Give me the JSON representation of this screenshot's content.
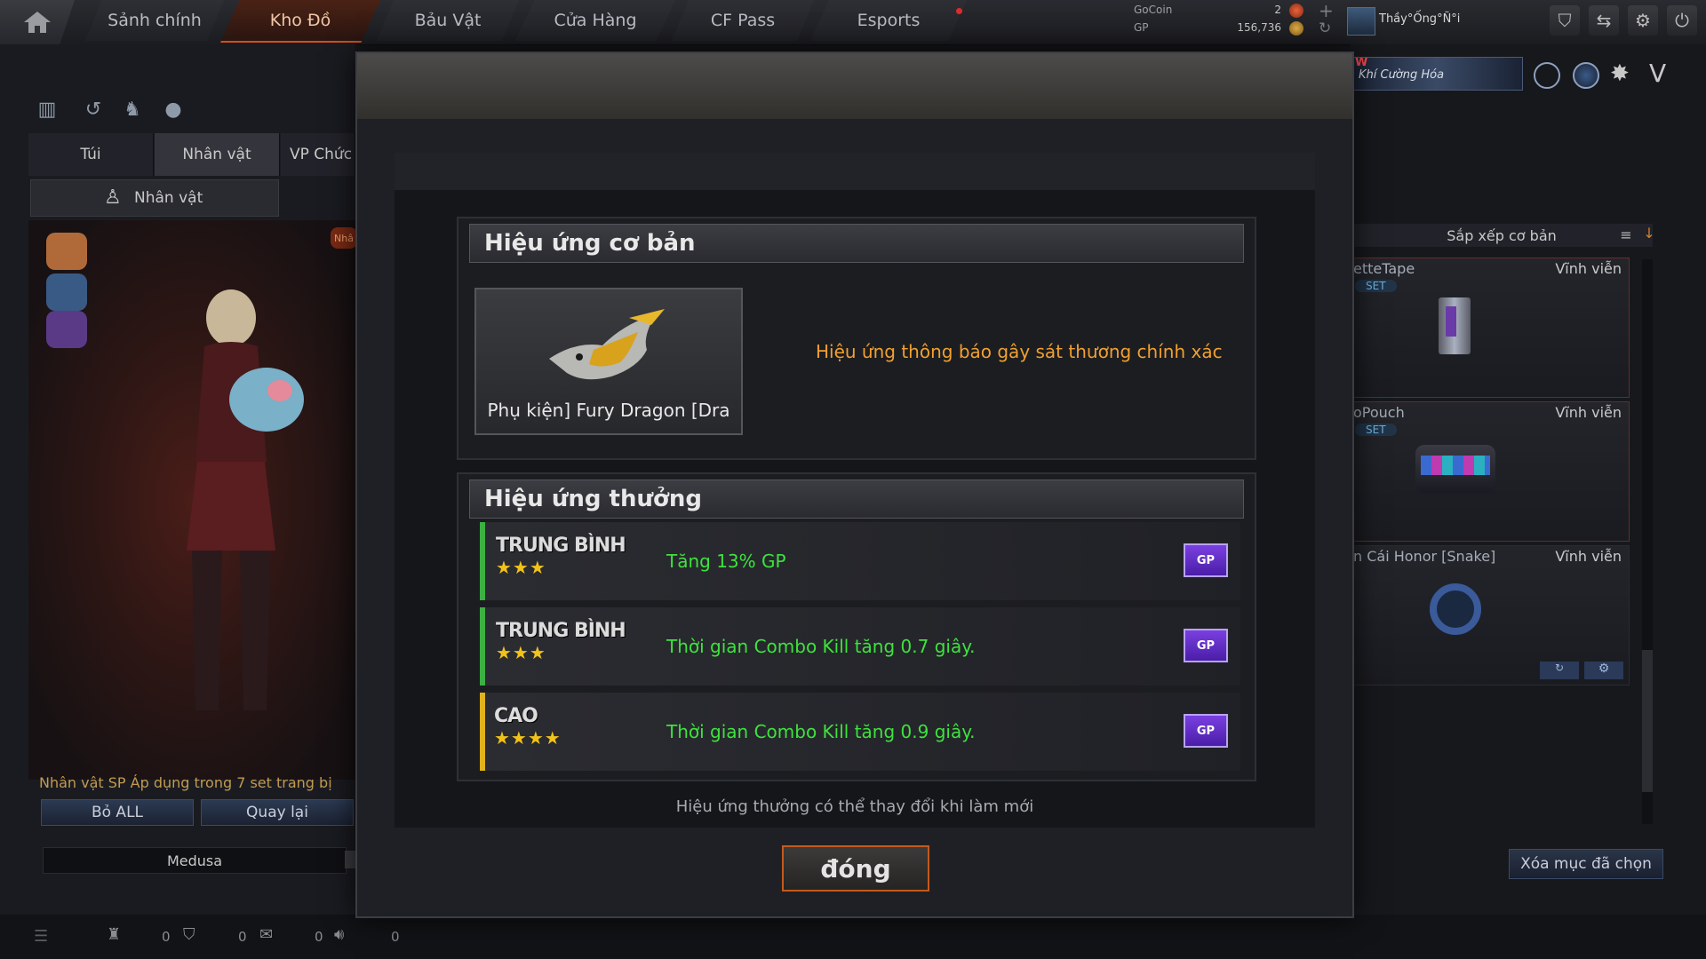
{
  "nav": {
    "tabs": [
      {
        "label": "Sảnh chính"
      },
      {
        "label": "Kho Đồ"
      },
      {
        "label": "Bảu Vật"
      },
      {
        "label": "Cửa Hàng"
      },
      {
        "label": "CF Pass"
      },
      {
        "label": "Esports"
      }
    ],
    "active_tab": "Kho Đồ"
  },
  "currency": {
    "gocoin_label": "GoCoin",
    "gocoin_value": "2",
    "gp_label": "GP",
    "gp_value": "156,736"
  },
  "user": {
    "name": "Thầy°Ống°Ñ°i"
  },
  "promo": {
    "new_badge": "W",
    "label": "Khí Cường Hóa"
  },
  "left_panel": {
    "tabs": [
      {
        "label": "Túi"
      },
      {
        "label": "Nhân vật"
      },
      {
        "label": "VP Chức"
      }
    ],
    "sub_tab": "Nhân vật",
    "side_tag": "Nhâ",
    "set_info": "Nhân vật SP Áp dụng trong 7 set trang bị",
    "remove_all": "Bỏ ALL",
    "back": "Quay lại",
    "character_name": "Medusa"
  },
  "right_panel": {
    "sort_label": "Sắp xếp cơ bản",
    "items": [
      {
        "name": "etteTape",
        "duration": "Vĩnh viễn",
        "badge": "SET"
      },
      {
        "name": "oPouch",
        "duration": "Vĩnh viễn",
        "badge": "SET"
      },
      {
        "name": "n Cái Honor [Snake]",
        "duration": "Vĩnh viễn",
        "badge": ""
      }
    ],
    "clear_selected": "Xóa mục đã chọn"
  },
  "bottom_bar": {
    "counts": [
      "0",
      "0",
      "0",
      "0"
    ]
  },
  "modal": {
    "basic_title": "Hiệu ứng cơ bản",
    "item_name": "Phụ kiện] Fury Dragon [Dra",
    "basic_effect": "Hiệu ứng thông báo gây sát thương chính xác",
    "bonus_title": "Hiệu ứng thưởng",
    "bonus_effects": [
      {
        "grade": "TRUNG BÌNH",
        "stars": "★★★",
        "text": "Tăng 13% GP",
        "color": "#3cb043"
      },
      {
        "grade": "TRUNG BÌNH",
        "stars": "★★★",
        "text": "Thời gian Combo Kill tăng 0.7 giây.",
        "color": "#3cb043"
      },
      {
        "grade": "CAO",
        "stars": "★★★★",
        "text": "Thời gian Combo Kill tăng 0.9 giây.",
        "color": "#e0b21c"
      }
    ],
    "gp_label": "GP",
    "note": "Hiệu ứng thưởng có thể thay đổi khi làm mới",
    "close": "đóng"
  },
  "colors": {
    "accent": "#d0501c",
    "effect_green": "#3ee23e",
    "basic_effect_orange": "#f0a030"
  }
}
